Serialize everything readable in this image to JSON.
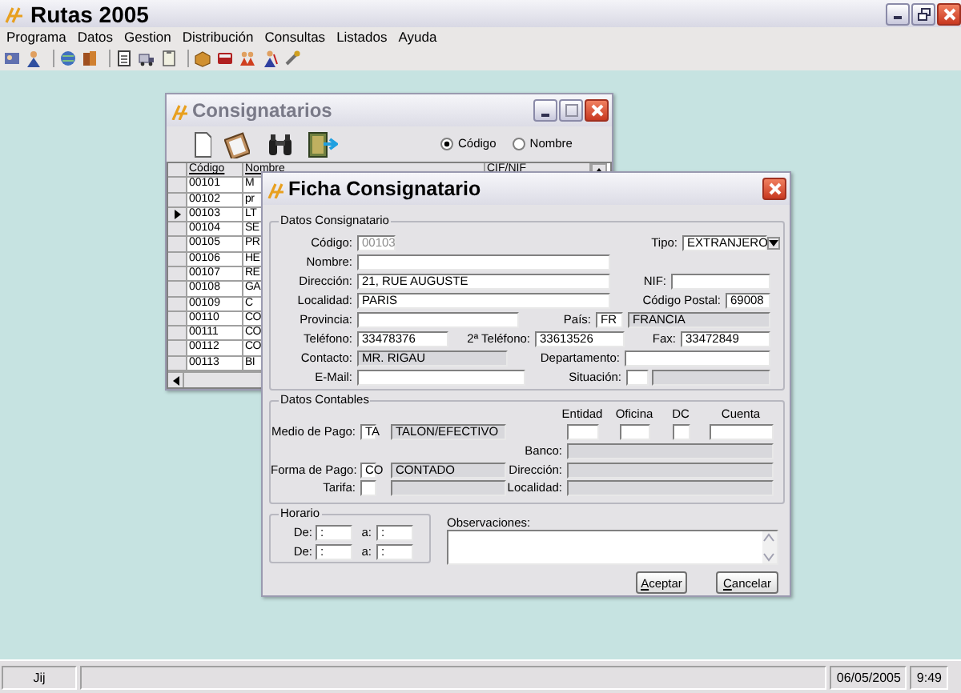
{
  "window": {
    "title": "Rutas 2005"
  },
  "menu": [
    "Programa",
    "Datos",
    "Gestion",
    "Distribución",
    "Consultas",
    "Listados",
    "Ayuda"
  ],
  "consignatarios": {
    "title": "Consignatarios",
    "sort_options": [
      {
        "label": "Código",
        "selected": true
      },
      {
        "label": "Nombre",
        "selected": false
      }
    ],
    "columns": [
      "Código",
      "Nombre",
      "CIF/NIF"
    ],
    "rows": [
      {
        "codigo": "00101",
        "nombre": "M",
        "selected": false
      },
      {
        "codigo": "00102",
        "nombre": "pr",
        "selected": false
      },
      {
        "codigo": "00103",
        "nombre": "LT",
        "selected": true
      },
      {
        "codigo": "00104",
        "nombre": "SE",
        "selected": false
      },
      {
        "codigo": "00105",
        "nombre": "PR",
        "selected": false
      },
      {
        "codigo": "00106",
        "nombre": "HE",
        "selected": false
      },
      {
        "codigo": "00107",
        "nombre": "RE",
        "selected": false
      },
      {
        "codigo": "00108",
        "nombre": "GA",
        "selected": false
      },
      {
        "codigo": "00109",
        "nombre": "C",
        "selected": false
      },
      {
        "codigo": "00110",
        "nombre": "CO",
        "selected": false
      },
      {
        "codigo": "00111",
        "nombre": "CO",
        "selected": false
      },
      {
        "codigo": "00112",
        "nombre": "CO",
        "selected": false
      },
      {
        "codigo": "00113",
        "nombre": "BI",
        "selected": false
      }
    ]
  },
  "ficha": {
    "title": "Ficha Consignatario",
    "datos_consignatario": {
      "legend": "Datos Consignatario",
      "rows": [
        [
          {
            "label": "Código:",
            "value": "00103",
            "kind": "disabled"
          },
          {
            "label": "Tipo:",
            "value": "EXTRANJERO",
            "kind": "select"
          }
        ],
        [
          {
            "label": "Nombre:",
            "kind": "text"
          }
        ],
        [
          {
            "label": "Dirección:",
            "value": "21, RUE AUGUSTE",
            "kind": "text"
          },
          {
            "label": "NIF:",
            "kind": "text"
          }
        ],
        [
          {
            "label": "Localidad:",
            "value": "PARIS",
            "kind": "text"
          },
          {
            "label": "Código Postal:",
            "value": "69008",
            "kind": "text"
          }
        ],
        [
          {
            "label": "Provincia:",
            "kind": "text"
          },
          {
            "label": "País:",
            "value": "FR",
            "kind": "text"
          },
          {
            "value": "FRANCIA",
            "kind": "readonly"
          }
        ],
        [
          {
            "label": "Teléfono:",
            "value": "33478376",
            "kind": "text"
          },
          {
            "label": "2ª Teléfono:",
            "value": "33613526",
            "kind": "text"
          },
          {
            "label": "Fax:",
            "value": "33472849",
            "kind": "text"
          }
        ],
        [
          {
            "label": "Contacto:",
            "value": "MR. RIGAU",
            "kind": "readonly"
          },
          {
            "label": "Departamento:",
            "kind": "text"
          }
        ],
        [
          {
            "label": "E-Mail:",
            "kind": "text"
          },
          {
            "label": "Situación:",
            "kind": "text"
          },
          {
            "kind": "readonly"
          }
        ]
      ]
    },
    "datos_contables": {
      "legend": "Datos Contables",
      "payment_rows": [
        [
          {
            "label": "Medio de Pago:",
            "value": "TA",
            "kind": "text"
          },
          {
            "value": "TALON/EFECTIVO",
            "kind": "readonly"
          }
        ],
        [
          {
            "label": "Forma de Pago:",
            "value": "CO",
            "kind": "text"
          },
          {
            "value": "CONTADO",
            "kind": "readonly"
          }
        ],
        [
          {
            "label": "Tarifa:",
            "kind": "text"
          },
          {
            "kind": "readonly"
          }
        ]
      ],
      "bank": {
        "headers": [
          "Entidad",
          "Oficina",
          "DC",
          "Cuenta"
        ],
        "fields": [
          {
            "kind": "text"
          },
          {
            "kind": "text"
          },
          {
            "kind": "text"
          },
          {
            "kind": "text"
          }
        ],
        "rows": [
          {
            "label": "Banco:",
            "kind": "readonly"
          },
          {
            "label": "Dirección:",
            "kind": "readonly"
          },
          {
            "label": "Localidad:",
            "kind": "readonly"
          }
        ]
      }
    },
    "horario": {
      "legend": "Horario",
      "rows": [
        {
          "from_label": "De:",
          "from": ":",
          "to_label": "a:",
          "to": ":"
        },
        {
          "from_label": "De:",
          "from": ":",
          "to_label": "a:",
          "to": ":"
        }
      ]
    },
    "observaciones": {
      "label": "Observaciones:"
    },
    "buttons": [
      "Aceptar",
      "Cancelar"
    ]
  },
  "status_bar": {
    "user": "Jij",
    "date": "06/05/2005",
    "time": "9:49"
  }
}
